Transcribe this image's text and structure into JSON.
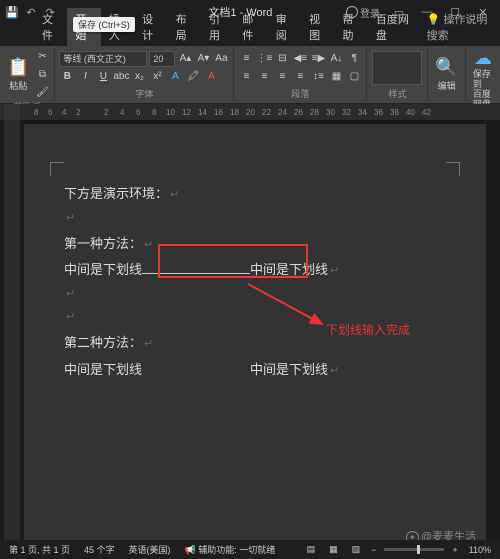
{
  "title": "文档1 - Word",
  "qat": {
    "save_tooltip": "保存 (Ctrl+S)"
  },
  "login": "登录",
  "tabs": {
    "file": "文件",
    "home": "开始",
    "insert": "插入",
    "design": "设计",
    "layout": "布局",
    "references": "引用",
    "mailings": "邮件",
    "review": "审阅",
    "view": "视图",
    "help": "帮助",
    "baidu": "百度网盘",
    "tell": "操作说明搜索"
  },
  "ribbon": {
    "clipboard": {
      "paste": "粘贴",
      "label": "剪贴板"
    },
    "font": {
      "name": "等线 (西文正文)",
      "size": "20",
      "label": "字体"
    },
    "paragraph": {
      "label": "段落"
    },
    "styles": {
      "label": "样式"
    },
    "editing": {
      "edit": "编辑"
    },
    "save": {
      "btn": "保存到\n百度网盘",
      "label": "保存"
    }
  },
  "ruler": {
    "marks": [
      "8",
      "6",
      "4",
      "2",
      "",
      "2",
      "4",
      "6",
      "8",
      "10",
      "12",
      "14",
      "16",
      "18",
      "20",
      "22",
      "24",
      "26",
      "28",
      "30",
      "32",
      "34",
      "36",
      "38",
      "40",
      "42"
    ]
  },
  "doc": {
    "l1": "下方是演示环境：",
    "l2": "第一种方法：",
    "l3a": "中间是下划线",
    "l3b": "中间是下划线",
    "l4": "第二种方法：",
    "l5a": "中间是下划线",
    "l5b": "中间是下划线",
    "annotation": "下划线输入完成"
  },
  "watermark": "@麦麦生活",
  "status": {
    "page": "第 1 页, 共 1 页",
    "words": "45 个字",
    "lang": "英语(美国)",
    "acc": "辅助功能: 一切就绪",
    "zoom": "110%"
  }
}
